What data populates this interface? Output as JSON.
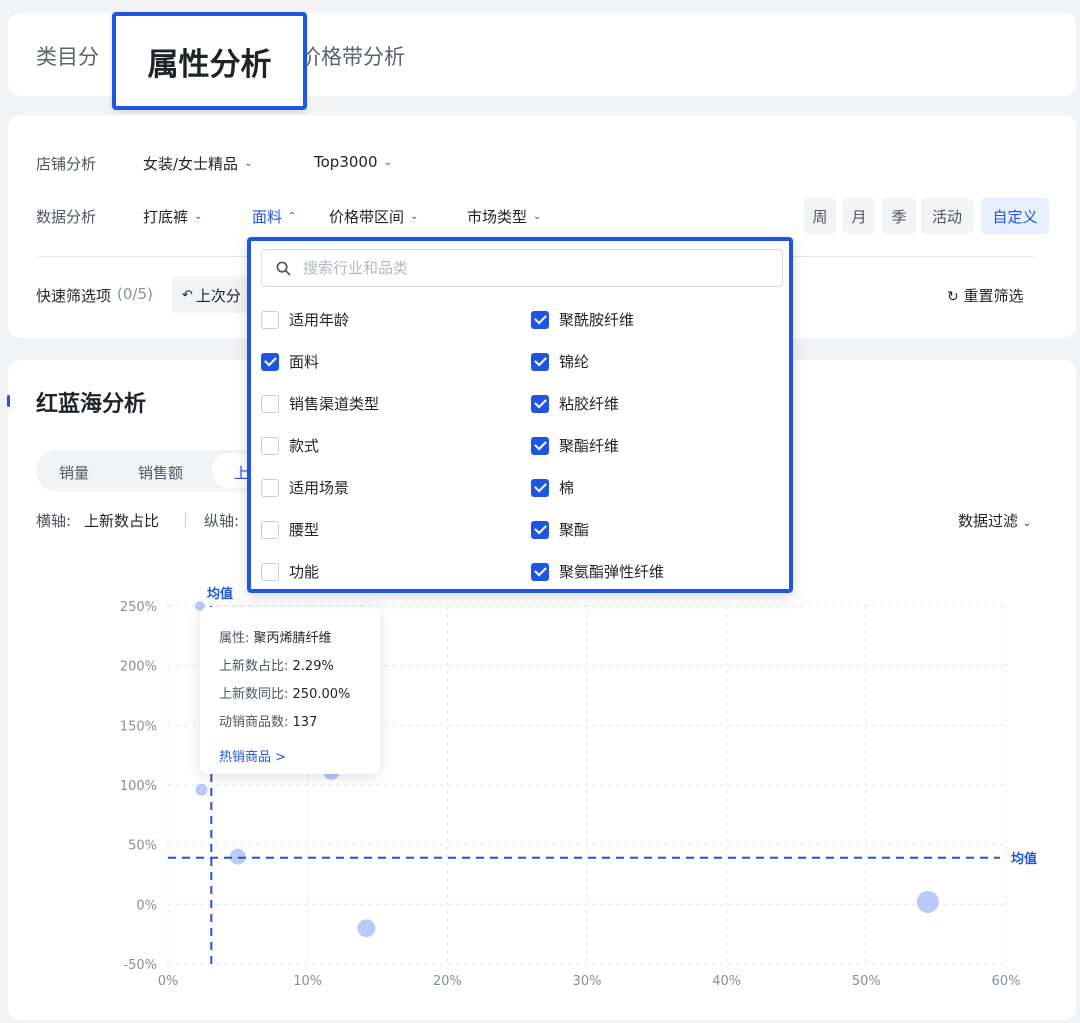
{
  "tabs": {
    "items": [
      {
        "label": "类目分析"
      },
      {
        "label": "属性分析"
      },
      {
        "label": "价格带分析"
      }
    ],
    "left_label": "类目分",
    "active_label": "属性分析",
    "right_label": "价格带分析"
  },
  "filters": {
    "store_label": "店铺分析",
    "store_category": "女装/女士精品",
    "store_rank": "Top3000",
    "data_label": "数据分析",
    "category": "打底裤",
    "attribute": "面料",
    "price_range": "价格带区间",
    "market_type": "市场类型",
    "periods": [
      "周",
      "月",
      "季",
      "活动",
      "自定义"
    ],
    "active_period": "自定义",
    "quick_filter_label": "快速筛选项",
    "quick_filter_count": "(0/5)",
    "last_button": "上次分",
    "reset_label": "重置筛选"
  },
  "dropdown": {
    "search_placeholder": "搜索行业和品类",
    "left_options": [
      {
        "label": "适用年龄",
        "checked": false
      },
      {
        "label": "面料",
        "checked": true
      },
      {
        "label": "销售渠道类型",
        "checked": false
      },
      {
        "label": "款式",
        "checked": false
      },
      {
        "label": "适用场景",
        "checked": false
      },
      {
        "label": "腰型",
        "checked": false
      },
      {
        "label": "功能",
        "checked": false
      }
    ],
    "right_options": [
      {
        "label": "聚酰胺纤维",
        "checked": true
      },
      {
        "label": "锦纶",
        "checked": true
      },
      {
        "label": "粘胶纤维",
        "checked": true
      },
      {
        "label": "聚酯纤维",
        "checked": true
      },
      {
        "label": "棉",
        "checked": true
      },
      {
        "label": "聚酯",
        "checked": true
      },
      {
        "label": "聚氨酯弹性纤维",
        "checked": true
      }
    ]
  },
  "analysis": {
    "title": "红蓝海分析",
    "segments": [
      "销量",
      "销售额",
      "上"
    ],
    "x_axis_label": "横轴:",
    "x_axis_value": "上新数占比",
    "y_axis_label": "纵轴:",
    "data_filter": "数据过滤"
  },
  "tooltip": {
    "attr_label": "属性:",
    "attr_value": "聚丙烯腈纤维",
    "share_label": "上新数占比:",
    "share_value": "2.29%",
    "yoy_label": "上新数同比:",
    "yoy_value": "250.00%",
    "active_label": "动销商品数:",
    "active_value": "137",
    "link": "热销商品 >"
  },
  "chart_data": {
    "type": "scatter",
    "x_ticks": [
      "0%",
      "10%",
      "20%",
      "30%",
      "40%",
      "50%",
      "60%"
    ],
    "y_ticks": [
      "250%",
      "200%",
      "150%",
      "100%",
      "50%",
      "0%",
      "-50%"
    ],
    "xlim": [
      0,
      60
    ],
    "ylim": [
      -50,
      250
    ],
    "mean_x": 3.1,
    "mean_y": 39,
    "mean_label": "均值",
    "accent": "#1f55e0",
    "point_color": "#aebff5",
    "points": [
      {
        "x": 2.29,
        "y": 250,
        "size": 5
      },
      {
        "x": 2.4,
        "y": 96,
        "size": 6
      },
      {
        "x": 5.0,
        "y": 40,
        "size": 8
      },
      {
        "x": 11.7,
        "y": 111,
        "size": 8
      },
      {
        "x": 14.2,
        "y": -20,
        "size": 9
      },
      {
        "x": 54.4,
        "y": 2,
        "size": 11
      }
    ]
  }
}
